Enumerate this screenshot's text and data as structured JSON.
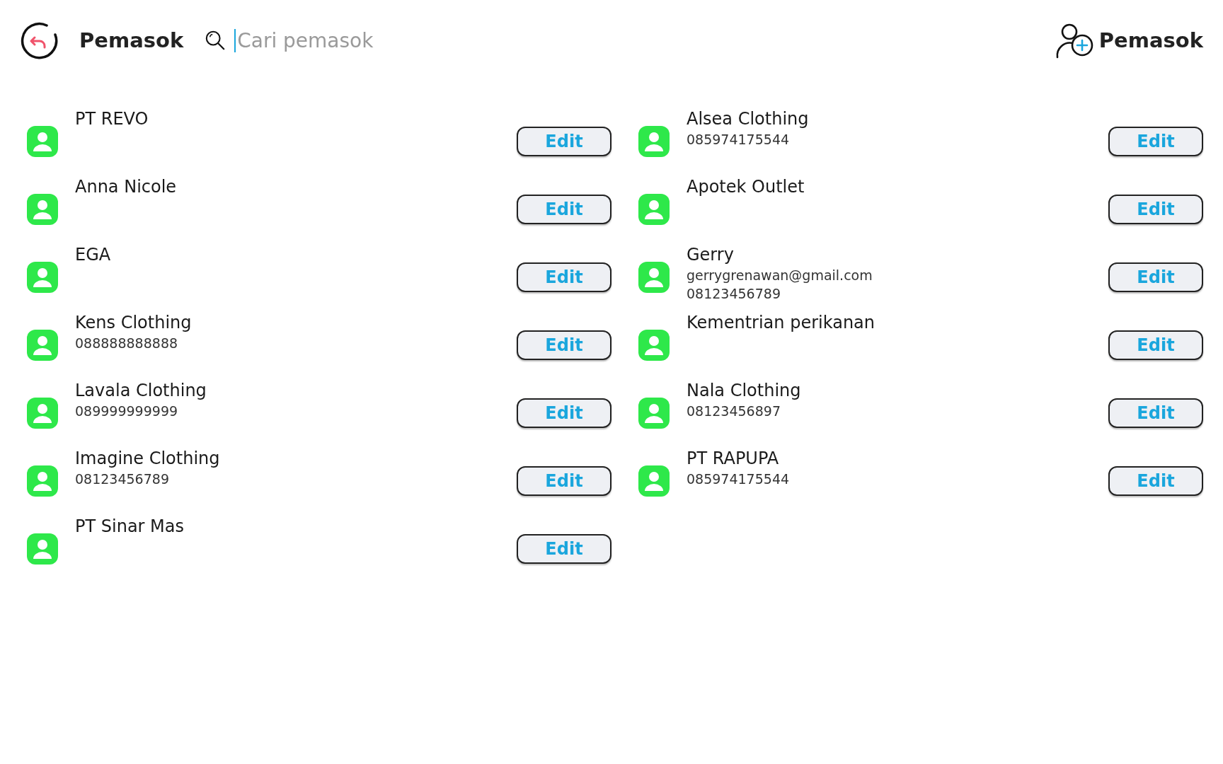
{
  "header": {
    "title": "Pemasok",
    "search": {
      "placeholder": "Cari pemasok"
    },
    "add_button": "Pemasok"
  },
  "columns": [
    [
      {
        "name": "PT REVO",
        "button": "Edit"
      },
      {
        "name": "Anna Nicole",
        "button": "Edit"
      },
      {
        "name": "EGA",
        "button": "Edit"
      },
      {
        "name": "Kens Clothing",
        "details": [
          "088888888888"
        ],
        "button": "Edit"
      },
      {
        "name": "Lavala Clothing",
        "details": [
          "089999999999"
        ],
        "button": "Edit"
      },
      {
        "name": "Imagine Clothing",
        "details": [
          "08123456789"
        ],
        "button": "Edit"
      },
      {
        "name": "PT Sinar Mas",
        "button": "Edit"
      }
    ],
    [
      {
        "name": "Alsea Clothing",
        "details": [
          "085974175544"
        ],
        "button": "Edit"
      },
      {
        "name": "Apotek Outlet",
        "button": "Edit"
      },
      {
        "name": "Gerry",
        "details": [
          "gerrygrenawan@gmail.com",
          "08123456789"
        ],
        "button": "Edit"
      },
      {
        "name": "Kementrian perikanan",
        "button": "Edit"
      },
      {
        "name": "Nala Clothing",
        "details": [
          "08123456897"
        ],
        "button": "Edit"
      },
      {
        "name": "PT RAPUPA",
        "details": [
          "085974175544"
        ],
        "button": "Edit"
      }
    ]
  ]
}
